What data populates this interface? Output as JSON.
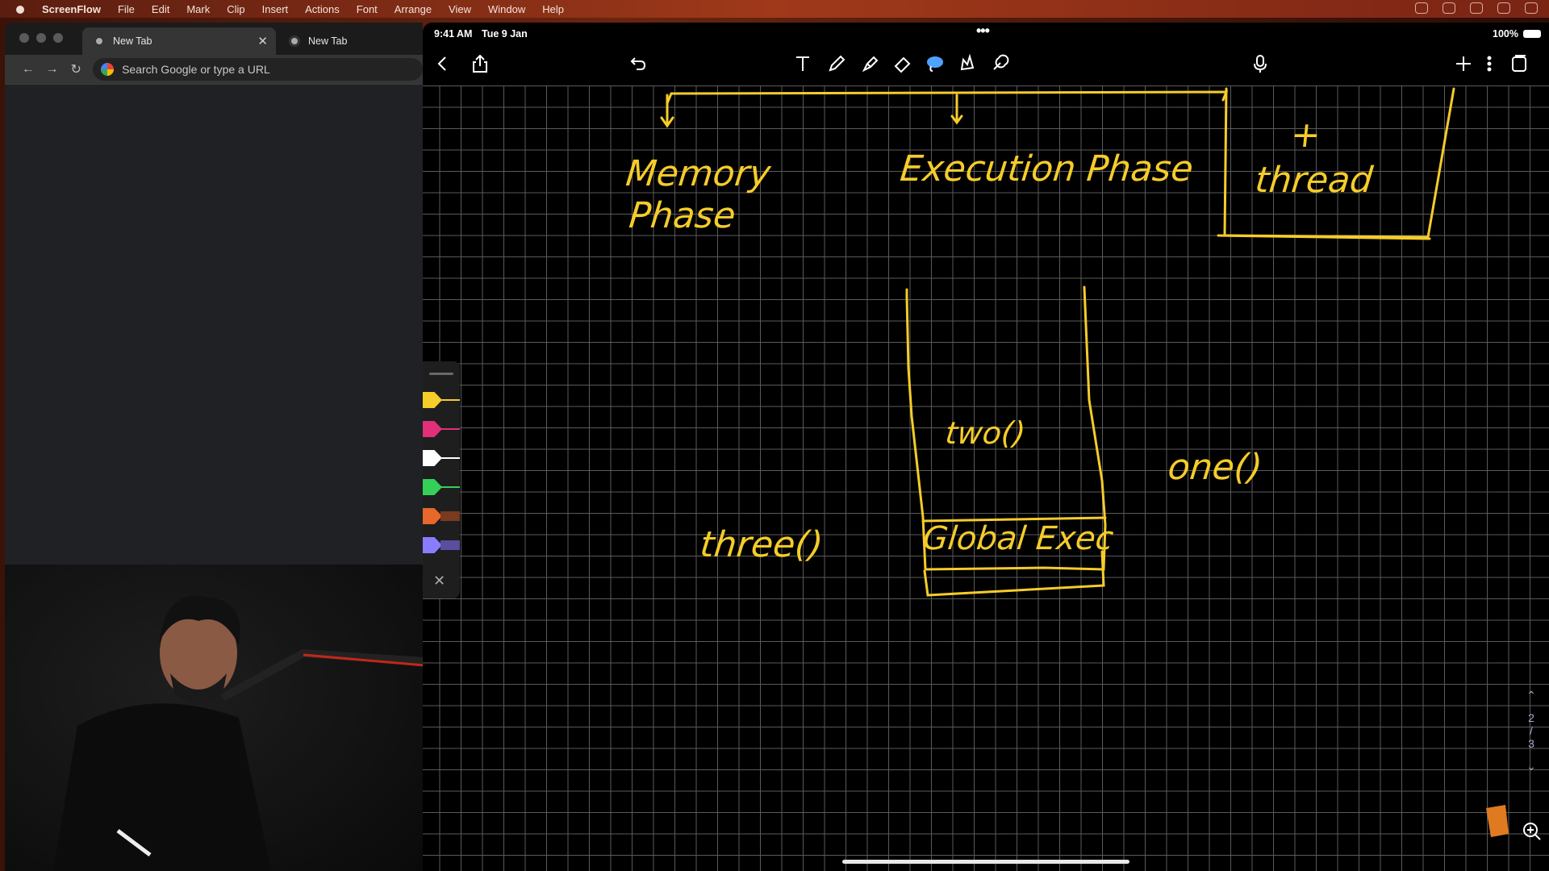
{
  "menubar": {
    "app": "ScreenFlow",
    "items": [
      "File",
      "Edit",
      "Mark",
      "Clip",
      "Insert",
      "Actions",
      "Font",
      "Arrange",
      "View",
      "Window",
      "Help"
    ]
  },
  "browser": {
    "tabs": [
      {
        "label": "New Tab"
      },
      {
        "label": "New Tab"
      }
    ],
    "omnibox_placeholder": "Search Google or type a URL"
  },
  "ipad": {
    "status": {
      "time": "9:41 AM",
      "date": "Tue 9 Jan",
      "battery": "100%"
    },
    "pager": {
      "current": "2",
      "separator": "/",
      "total": "3"
    }
  },
  "notes": {
    "memory_phase_1": "Memory",
    "memory_phase_2": "Phase",
    "execution_phase": "Execution Phase",
    "plus": "+",
    "thread": "thread",
    "two": "two()",
    "one": "one()",
    "three": "three()",
    "global_exec": "Global Exec"
  },
  "colors": {
    "ink": "#f5cc2a",
    "palette": [
      "#f5cc2a",
      "#e0307a",
      "#ffffff",
      "#34d058",
      "#e8672a",
      "#8a7cff"
    ]
  }
}
